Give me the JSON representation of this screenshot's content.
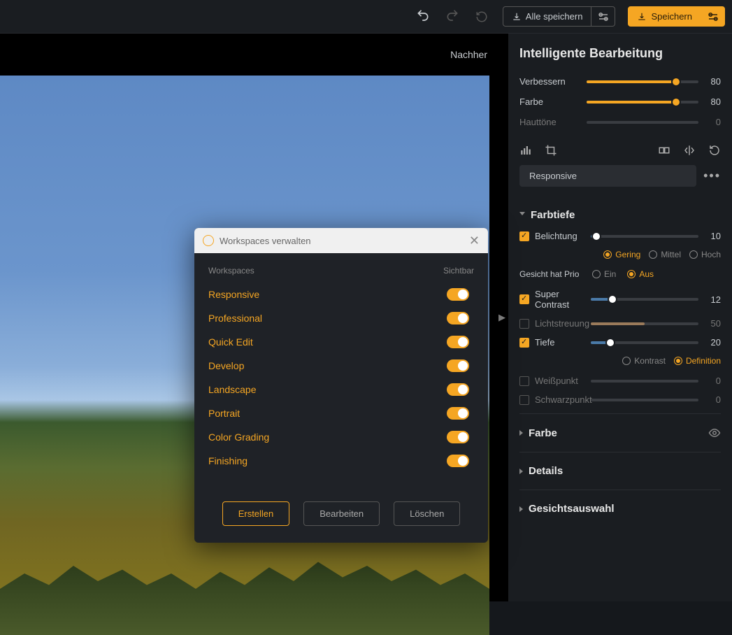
{
  "topbar": {
    "save_all": "Alle speichern",
    "save": "Speichern"
  },
  "canvas": {
    "compare_label": "Nachher"
  },
  "modal": {
    "title": "Workspaces verwalten",
    "col_name": "Workspaces",
    "col_visible": "Sichtbar",
    "items": [
      {
        "name": "Responsive"
      },
      {
        "name": "Professional"
      },
      {
        "name": "Quick Edit"
      },
      {
        "name": "Develop"
      },
      {
        "name": "Landscape"
      },
      {
        "name": "Portrait"
      },
      {
        "name": "Color Grading"
      },
      {
        "name": "Finishing"
      }
    ],
    "create": "Erstellen",
    "edit": "Bearbeiten",
    "delete": "Löschen"
  },
  "panel": {
    "title": "Intelligente Bearbeitung",
    "sliders": {
      "verbessern": {
        "label": "Verbessern",
        "value": "80",
        "pct": 80
      },
      "farbe": {
        "label": "Farbe",
        "value": "80",
        "pct": 80
      },
      "hauttoene": {
        "label": "Hauttöne",
        "value": "0",
        "pct": 0
      }
    },
    "workspace_selected": "Responsive",
    "sections": {
      "farbtiefe": "Farbtiefe",
      "farbe": "Farbe",
      "details": "Details",
      "gesicht": "Gesichtsauswahl"
    },
    "farbtiefe": {
      "belichtung": {
        "label": "Belichtung",
        "value": "10",
        "pct": 5
      },
      "strength_opts": {
        "gering": "Gering",
        "mittel": "Mittel",
        "hoch": "Hoch"
      },
      "face_prio_label": "Gesicht hat Prio",
      "face_opts": {
        "ein": "Ein",
        "aus": "Aus"
      },
      "super_contrast": {
        "label": "Super Contrast",
        "value": "12",
        "pct": 20
      },
      "lichtstreuung": {
        "label": "Lichtstreuung",
        "value": "50",
        "pct": 50
      },
      "tiefe": {
        "label": "Tiefe",
        "value": "20",
        "pct": 18
      },
      "tiefe_opts": {
        "kontrast": "Kontrast",
        "definition": "Definition"
      },
      "weisspunkt": {
        "label": "Weißpunkt",
        "value": "0",
        "pct": 0
      },
      "schwarzpunkt": {
        "label": "Schwarzpunkt",
        "value": "0",
        "pct": 0
      }
    }
  }
}
